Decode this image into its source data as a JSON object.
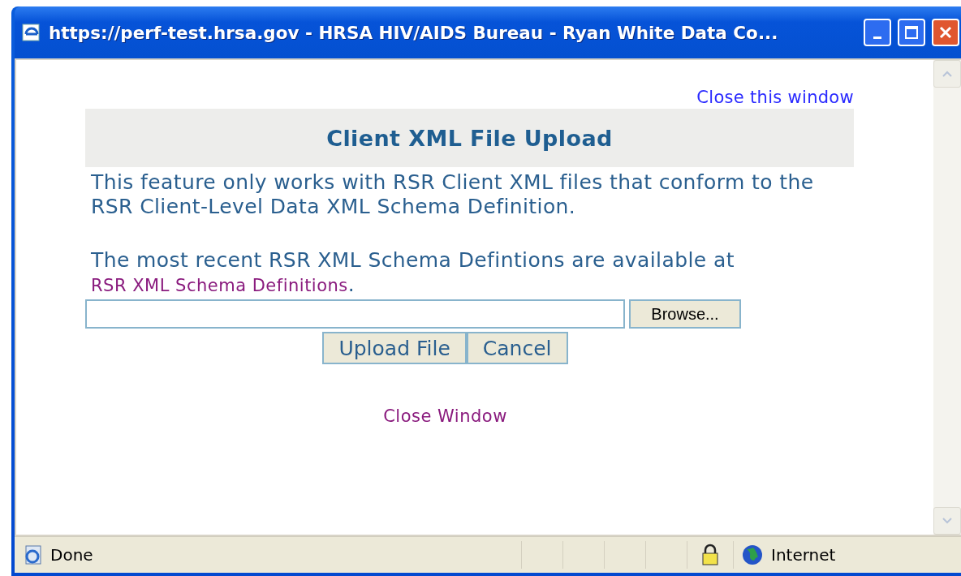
{
  "window": {
    "title": "https://perf-test.hrsa.gov - HRSA HIV/AIDS Bureau - Ryan White Data Co..."
  },
  "page": {
    "close_link_top": "Close this window",
    "heading": "Client XML File Upload",
    "intro": "This feature only works with RSR Client XML files that conform to the RSR Client-Level Data XML Schema Definition.",
    "schema_note": {
      "text": "The most recent RSR XML Schema Defintions are available at ",
      "link": "RSR XML Schema Definitions",
      "after": "."
    },
    "browse_button": "Browse...",
    "buttons": [
      "Upload File",
      "Cancel"
    ],
    "close_link_bottom": "Close Window"
  },
  "status_bar": {
    "text": "Done",
    "zone": "Internet"
  }
}
